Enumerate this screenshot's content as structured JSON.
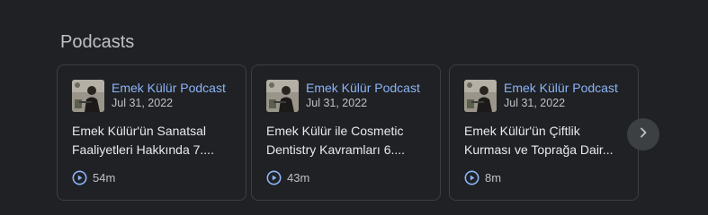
{
  "section": {
    "title": "Podcasts"
  },
  "cards": [
    {
      "podcast": "Emek Külür Podcast",
      "date": "Jul 31, 2022",
      "episode_line1": "Emek Külür'ün Sanatsal",
      "episode_line2": "Faaliyetleri Hakkında 7....",
      "duration": "54m"
    },
    {
      "podcast": "Emek Külür Podcast",
      "date": "Jul 31, 2022",
      "episode_line1": "Emek Külür ile Cosmetic",
      "episode_line2": "Dentistry Kavramları 6....",
      "duration": "43m"
    },
    {
      "podcast": "Emek Külür Podcast",
      "date": "Jul 31, 2022",
      "episode_line1": "Emek Külür'ün Çiftlik",
      "episode_line2": "Kurması ve Toprağa Dair...",
      "duration": "8m"
    }
  ],
  "icons": {
    "play": "play-circle-icon",
    "next": "chevron-right-icon"
  },
  "colors": {
    "accent": "#8ab4f8",
    "background": "#202124",
    "card_border": "#3c4043"
  }
}
